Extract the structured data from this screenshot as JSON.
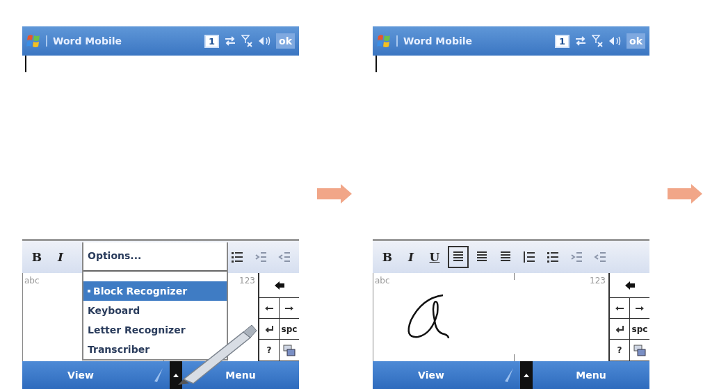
{
  "screens": [
    {
      "title": "Word Mobile",
      "notification": "1",
      "ok": "ok",
      "toolbar": [
        {
          "kind": "bold",
          "label": "B",
          "selected": false
        },
        {
          "kind": "italic",
          "label": "I",
          "selected": false
        },
        {
          "kind": "bullet-list",
          "selected": false
        },
        {
          "kind": "indent",
          "selected": false
        },
        {
          "kind": "outdent",
          "selected": false
        }
      ],
      "panel": {
        "left_label": "abc",
        "right_label": "123",
        "ink_stroke": false,
        "keys": [
          {
            "kind": "backspace"
          },
          {
            "kind": "left"
          },
          {
            "kind": "right"
          },
          {
            "kind": "enter"
          },
          {
            "kind": "text",
            "label": "spc"
          },
          {
            "kind": "text",
            "label": "?"
          },
          {
            "kind": "keyboard"
          }
        ]
      },
      "input_menu": {
        "items": [
          {
            "label": "Options...",
            "selected": false
          },
          {
            "label": "Block Recognizer",
            "selected": true
          },
          {
            "label": "Keyboard",
            "selected": false
          },
          {
            "label": "Letter Recognizer",
            "selected": false
          },
          {
            "label": "Transcriber",
            "selected": false
          }
        ]
      },
      "stylus": true,
      "softkeys": [
        "View",
        "Menu"
      ]
    },
    {
      "title": "Word Mobile",
      "notification": "1",
      "ok": "ok",
      "toolbar": [
        {
          "kind": "bold",
          "label": "B",
          "selected": false
        },
        {
          "kind": "italic",
          "label": "I",
          "selected": false
        },
        {
          "kind": "underline",
          "label": "U",
          "selected": false
        },
        {
          "kind": "align-left",
          "selected": true
        },
        {
          "kind": "align-center",
          "selected": false
        },
        {
          "kind": "align-right",
          "selected": false
        },
        {
          "kind": "numbered-list",
          "selected": false
        },
        {
          "kind": "bullet-list",
          "selected": false
        },
        {
          "kind": "indent",
          "selected": false
        },
        {
          "kind": "outdent",
          "selected": false
        }
      ],
      "panel": {
        "left_label": "abc",
        "right_label": "123",
        "ink_stroke": true,
        "keys": [
          {
            "kind": "backspace"
          },
          {
            "kind": "left"
          },
          {
            "kind": "right"
          },
          {
            "kind": "enter"
          },
          {
            "kind": "text",
            "label": "spc"
          },
          {
            "kind": "text",
            "label": "?"
          },
          {
            "kind": "keyboard"
          }
        ]
      },
      "stylus": false,
      "softkeys": [
        "View",
        "Menu"
      ]
    }
  ]
}
